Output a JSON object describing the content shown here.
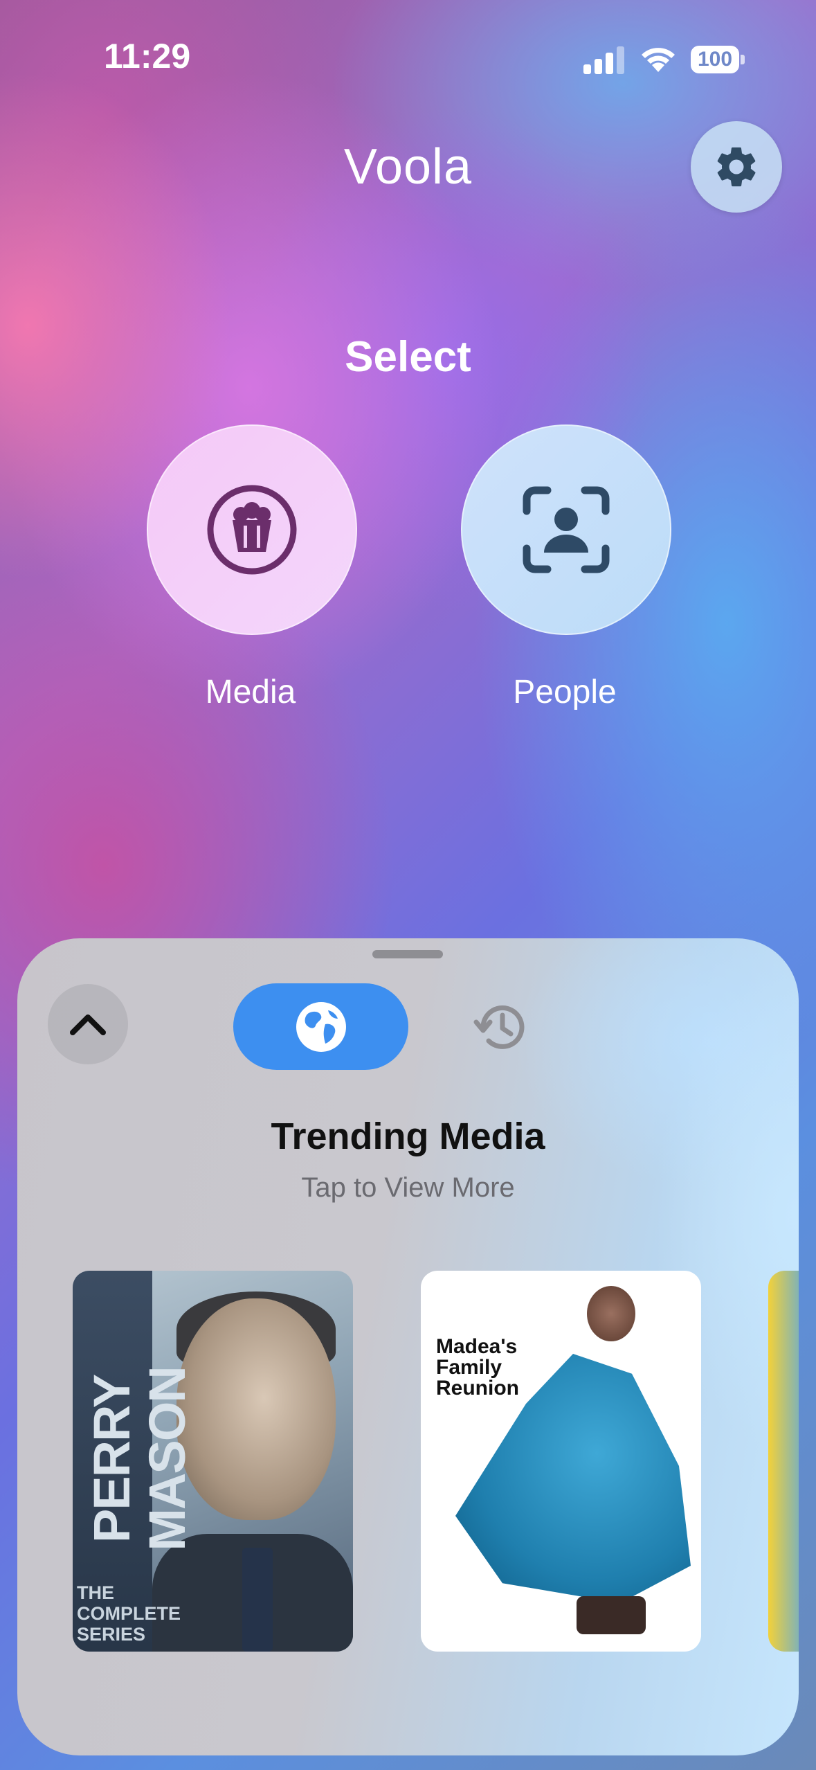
{
  "status_bar": {
    "time": "11:29",
    "battery": "100"
  },
  "header": {
    "app_title": "Voola",
    "settings_icon": "gear-icon"
  },
  "select": {
    "heading": "Select",
    "options": [
      {
        "label": "Media",
        "icon": "popcorn-icon"
      },
      {
        "label": "People",
        "icon": "person-scan-icon"
      }
    ]
  },
  "sheet": {
    "tabs": [
      {
        "icon": "globe-icon",
        "selected": true
      },
      {
        "icon": "history-icon",
        "selected": false
      }
    ],
    "title": "Trending Media",
    "subtitle": "Tap to View More",
    "posters": [
      {
        "title": "PERRY MASON",
        "subtitle": "THE COMPLETE SERIES"
      },
      {
        "title": "Madea's Family Reunion"
      }
    ]
  },
  "colors": {
    "accent_blue": "#3D8FF0",
    "media_circle": "#F5C9F7",
    "people_circle": "#CFE2FB",
    "media_icon": "#6B2E6B",
    "people_icon": "#2E4A66"
  }
}
